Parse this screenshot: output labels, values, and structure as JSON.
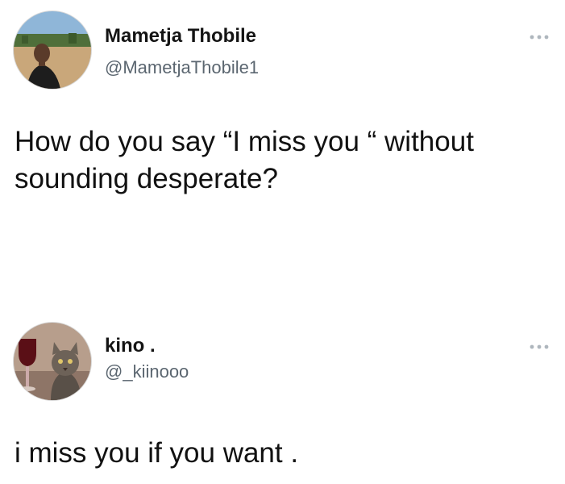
{
  "tweets": [
    {
      "author_name": "Mametja Thobile",
      "handle": "@MametjaThobile1",
      "body_lines": [
        "How do you say “I miss you “ without",
        "sounding desperate?"
      ],
      "more_icon": "more-options-icon"
    },
    {
      "author_name": "kino .",
      "handle": "@_kiinooo",
      "body_lines": [
        "i miss you if you want ."
      ],
      "more_icon": "more-options-icon"
    }
  ],
  "colors": {
    "name": "#141414",
    "handle": "#5b6670",
    "body": "#111111",
    "more_dots": "#aeb6bd"
  }
}
